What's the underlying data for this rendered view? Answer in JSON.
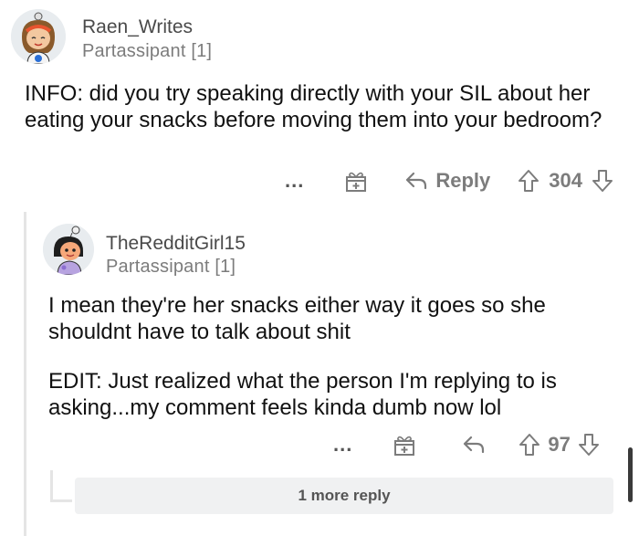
{
  "comment1": {
    "username": "Raen_Writes",
    "flair": "Partassipant [1]",
    "body": "INFO: did you try speaking directly with your SIL about her eating your snacks before moving them into your bedroom?",
    "actions": {
      "more": "...",
      "reply_label": "Reply",
      "score": "304"
    }
  },
  "comment2": {
    "username": "TheRedditGirl15",
    "flair": "Partassipant [1]",
    "body_p1": "I mean they're her snacks either way it goes so she shouldnt have to talk about shit",
    "body_p2": "EDIT: Just realized what the person I'm replying to is asking...my comment feels kinda dumb now lol",
    "actions": {
      "more": "...",
      "score": "97"
    },
    "more_replies": "1 more reply"
  },
  "colors": {
    "text": "#1a1a1b",
    "muted": "#7c7c7c",
    "thread_line": "#e5e5e5",
    "more_reply_bg": "#f0f1f2"
  }
}
